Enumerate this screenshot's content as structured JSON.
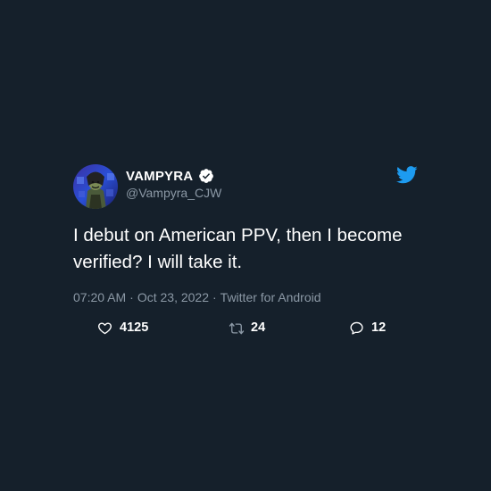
{
  "tweet": {
    "display_name": "VAMPYRA",
    "handle": "@Vampyra_CJW",
    "text": "I debut on American PPV, then I become verified? I will take it.",
    "time": "07:20 AM",
    "date": "Oct 23, 2022",
    "source": "Twitter for Android",
    "separator": "·",
    "verified": true
  },
  "stats": {
    "likes": "4125",
    "retweets": "24",
    "replies": "12"
  },
  "colors": {
    "background": "#15202b",
    "text": "#ffffff",
    "secondary_text": "#8b98a5",
    "twitter_blue": "#1d9bf0"
  },
  "icons": {
    "brand": "twitter-bird-icon",
    "verified": "verified-badge-icon",
    "like": "heart-icon",
    "retweet": "retweet-icon",
    "reply": "reply-bubble-icon"
  }
}
